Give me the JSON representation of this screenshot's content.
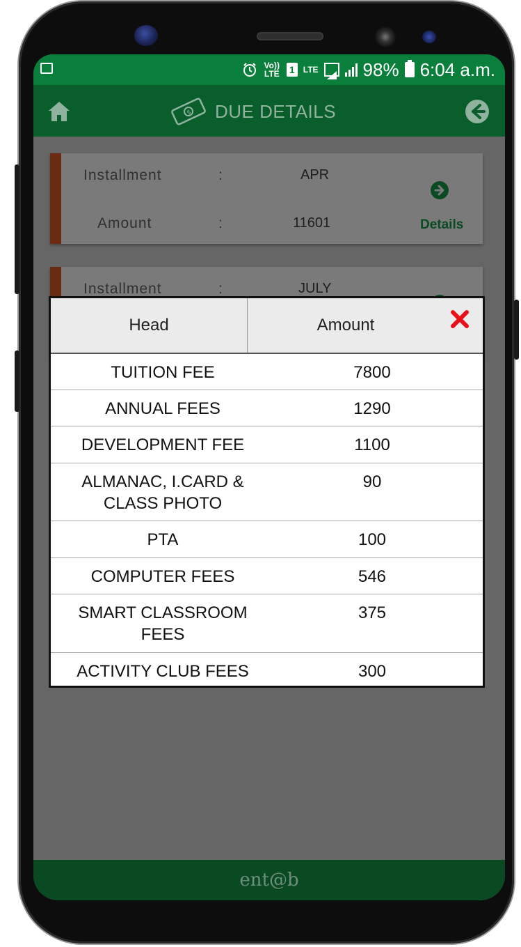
{
  "status_bar": {
    "volte": "Vo)) LTE",
    "sim": "1",
    "lte": "LTE",
    "battery_percent": "98%",
    "time": "6:04 a.m."
  },
  "app_bar": {
    "title": "DUE DETAILS"
  },
  "cards": [
    {
      "installment_label": "Installment",
      "installment_value": "APR",
      "amount_label": "Amount",
      "amount_value": "11601",
      "details_label": "Details"
    },
    {
      "installment_label": "Installment",
      "installment_value": "JULY"
    }
  ],
  "colon": ":",
  "modal": {
    "columns": {
      "head": "Head",
      "amount": "Amount"
    },
    "rows": [
      {
        "head": "TUITION FEE",
        "amount": "7800"
      },
      {
        "head": "ANNUAL FEES",
        "amount": "1290"
      },
      {
        "head": "DEVELOPMENT FEE",
        "amount": "1100"
      },
      {
        "head": "ALMANAC, I.CARD & CLASS PHOTO",
        "amount": "90"
      },
      {
        "head": "PTA",
        "amount": "100"
      },
      {
        "head": "COMPUTER FEES",
        "amount": "546"
      },
      {
        "head": "SMART CLASSROOM FEES",
        "amount": "375"
      },
      {
        "head": "ACTIVITY CLUB FEES",
        "amount": "300"
      }
    ]
  },
  "footer": {
    "brand": "ent@b"
  },
  "colors": {
    "status_green": "#0a7f3c",
    "appbar_green_dimmed": "#0a5e2c",
    "card_accent": "#6b2a12",
    "close_red": "#e8101a"
  },
  "icons": [
    "home-icon",
    "money-icon",
    "back-arrow-icon",
    "arrow-right-circle-icon",
    "close-icon",
    "alarm-icon",
    "signal-icon",
    "battery-icon",
    "image-icon"
  ]
}
